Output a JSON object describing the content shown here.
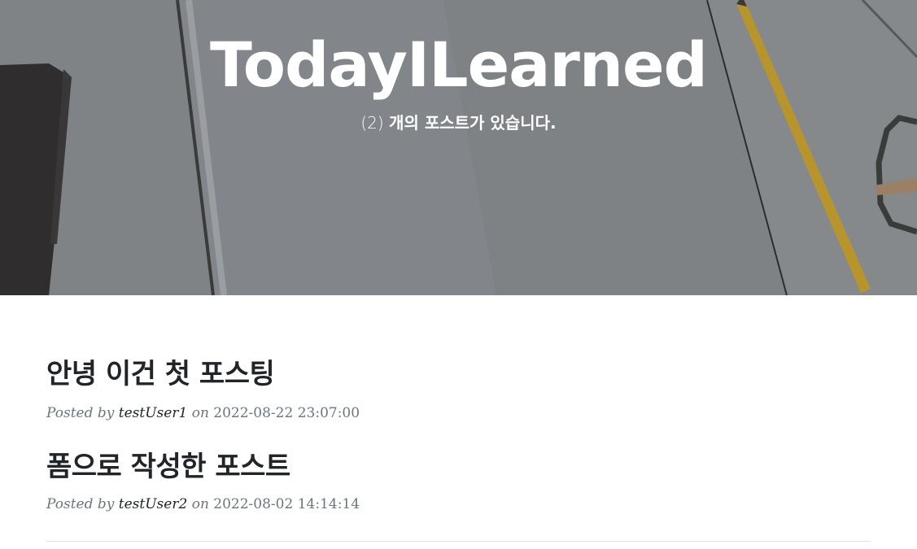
{
  "header": {
    "title": "TodayILearned",
    "post_count_text": "(2)",
    "subtitle_text": "개의 포스트가 있습니다."
  },
  "posts": [
    {
      "title": "안녕 이건 첫 포스팅",
      "posted_by_label": "Posted by",
      "author": "testUser1",
      "on_label": "on",
      "date": "2022-08-22 23:07:00"
    },
    {
      "title": "폼으로 작성한 포스트",
      "posted_by_label": "Posted by",
      "author": "testUser2",
      "on_label": "on",
      "date": "2022-08-02 14:14:14"
    }
  ],
  "colors": {
    "heading": "#212529",
    "meta": "#6c757d",
    "header_bg": "#8c8e92"
  }
}
